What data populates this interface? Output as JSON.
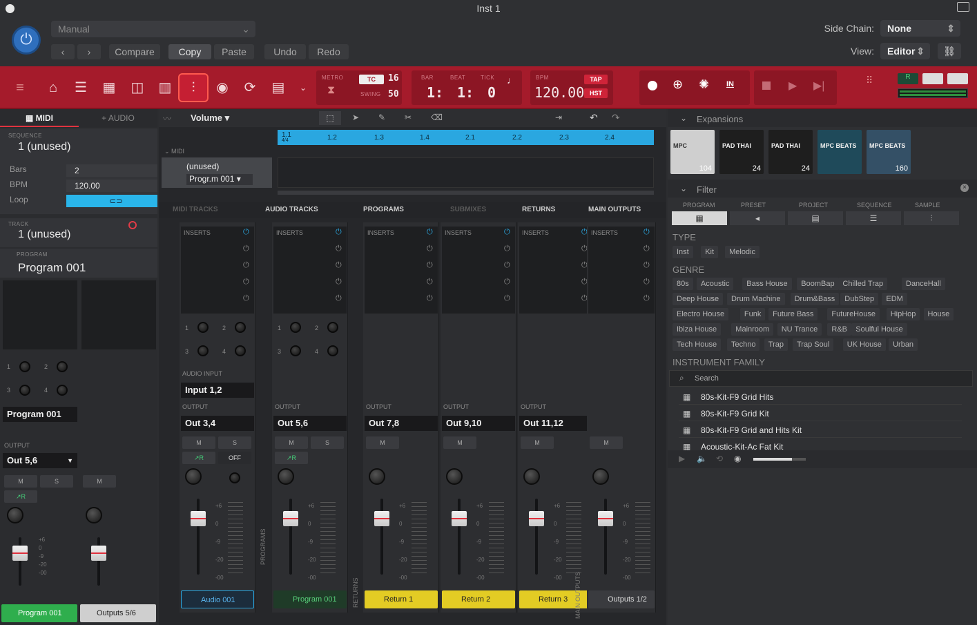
{
  "window": {
    "title": "Inst 1"
  },
  "header": {
    "preset": "Manual",
    "buttons": [
      "Compare",
      "Copy",
      "Paste",
      "Undo",
      "Redo"
    ],
    "sidechain_label": "Side Chain:",
    "sidechain_value": "None",
    "view_label": "View:",
    "view_value": "Editor"
  },
  "transport": {
    "metro": "METRO",
    "tc": "TC",
    "tc_val": "16",
    "swing": "SWING",
    "swing_val": "50",
    "bar_label": "BAR",
    "beat_label": "BEAT",
    "tick_label": "TICK",
    "bar": "1:",
    "beat": "1:",
    "tick": "0",
    "bpm_label": "BPM",
    "bpm": "120.00",
    "tap": "TAP",
    "hst": "HST",
    "in": "IN"
  },
  "left": {
    "tab_midi": "MIDI",
    "tab_audio": "AUDIO",
    "seq_label": "SEQUENCE",
    "seq_value": "1 (unused)",
    "bars_label": "Bars",
    "bars": "2",
    "bpm_label": "BPM",
    "bpm": "120.00",
    "loop_label": "Loop",
    "track_label": "TRACK",
    "track_value": "1 (unused)",
    "program_label": "PROGRAM",
    "program_value": "Program 001",
    "knob1": "1",
    "knob2": "2",
    "knob3": "3",
    "knob4": "4",
    "strip_name": "Program 001",
    "output_label": "OUTPUT",
    "output": "Out 5,6",
    "m": "M",
    "s": "S",
    "r": "R",
    "db": [
      "+6",
      "0",
      "-9",
      "-20",
      "-00"
    ],
    "bottom1": "Program 001",
    "bottom2": "Outputs 5/6"
  },
  "center": {
    "param": "Volume",
    "ruler": [
      "1.1",
      "1.2",
      "1.3",
      "1.4",
      "2.1",
      "2.2",
      "2.3",
      "2.4"
    ],
    "ruler_sub": "4/4",
    "midi_label": "MIDI",
    "clip_name": "(unused)",
    "clip_program": "Progr.m 001",
    "tabs": [
      "MIDI TRACKS",
      "AUDIO TRACKS",
      "PROGRAMS",
      "SUBMIXES",
      "RETURNS",
      "MAIN OUTPUTS"
    ],
    "inserts": "INSERTS",
    "audio_input_label": "AUDIO INPUT",
    "audio_input": "Input 1,2",
    "output_label": "OUTPUT",
    "strips": [
      {
        "out": "Out 3,4",
        "tag": "Audio 001"
      },
      {
        "out": "Out 5,6",
        "tag": "Program 001"
      },
      {
        "out": "Out 7,8",
        "tag": "Return 1"
      },
      {
        "out": "Out 9,10",
        "tag": "Return 2"
      },
      {
        "out": "Out 11,12",
        "tag": "Return 3"
      },
      {
        "out": "",
        "tag": "Outputs 1/2"
      }
    ],
    "off": "OFF",
    "side_labels": [
      "PROGRAMS",
      "RETURNS",
      "MAIN OUTPUTS"
    ]
  },
  "right": {
    "expansions": "Expansions",
    "thumbs": [
      "104",
      "24",
      "24",
      "",
      "160"
    ],
    "thumb_text": [
      "MPC",
      "PAD THAI",
      "PAD THAI",
      "MPC BEATS",
      "MPC BEATS"
    ],
    "filter": "Filter",
    "cats": [
      "PROGRAM",
      "PRESET",
      "PROJECT",
      "SEQUENCE",
      "SAMPLE"
    ],
    "type_label": "TYPE",
    "types": [
      "Inst",
      "Kit",
      "Melodic"
    ],
    "genre_label": "GENRE",
    "genres": [
      [
        "80s",
        "Acoustic",
        "Bass House",
        "BoomBap",
        "Chilled Trap",
        "DanceHall"
      ],
      [
        "Deep House",
        "Drum Machine",
        "Drum&Bass",
        "DubStep",
        "EDM"
      ],
      [
        "Electro House",
        "Funk",
        "Future Bass",
        "FutureHouse",
        "HipHop",
        "House"
      ],
      [
        "Ibiza House",
        "Mainroom",
        "NU Trance",
        "R&B",
        "Soulful House"
      ],
      [
        "Tech House",
        "Techno",
        "Trap",
        "Trap Soul",
        "UK House",
        "Urban"
      ]
    ],
    "instfam_label": "INSTRUMENT FAMILY",
    "search_placeholder": "Search",
    "results": [
      "80s-Kit-F9 Grid Hits",
      "80s-Kit-F9 Grid Kit",
      "80s-Kit-F9 Grid and Hits Kit",
      "Acoustic-Kit-Ac Fat Kit"
    ]
  },
  "colors": {
    "transport_red": "#a51b2b",
    "accent_blue": "#2aa7e0",
    "return_yellow": "#e3cc24",
    "program_green": "#2fae4d"
  }
}
